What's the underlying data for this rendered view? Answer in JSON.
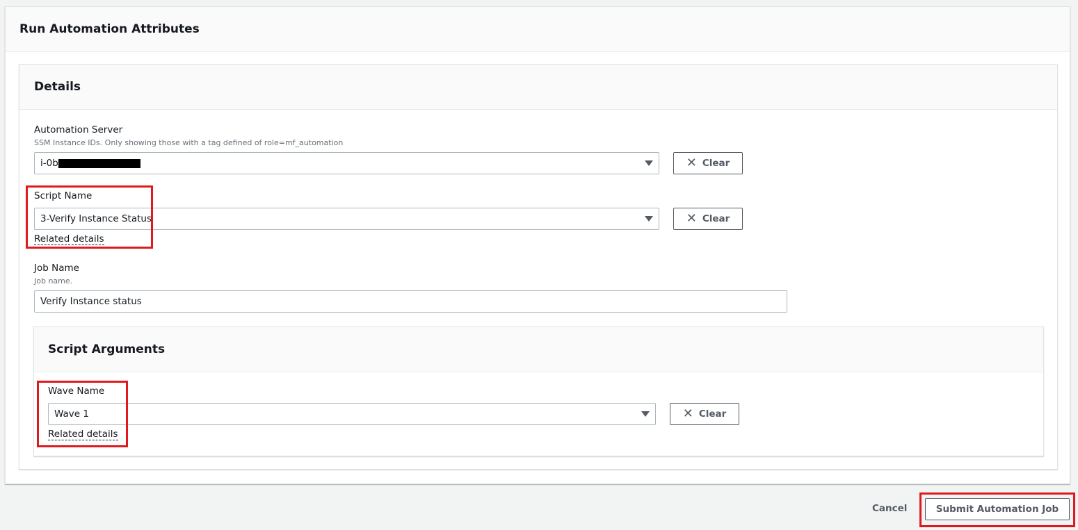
{
  "page": {
    "title": "Run Automation Attributes"
  },
  "details": {
    "title": "Details",
    "automation_server": {
      "label": "Automation Server",
      "description": "SSM Instance IDs. Only showing those with a tag defined of role=mf_automation",
      "value": "i-0b",
      "clear_label": "Clear"
    },
    "script_name": {
      "label": "Script Name",
      "value": "3-Verify Instance Status",
      "clear_label": "Clear",
      "related_link": "Related details"
    },
    "job_name": {
      "label": "Job Name",
      "description": "Job name.",
      "value": "Verify Instance status"
    }
  },
  "script_arguments": {
    "title": "Script Arguments",
    "wave_name": {
      "label": "Wave Name",
      "value": "Wave 1",
      "clear_label": "Clear",
      "related_link": "Related details"
    }
  },
  "footer": {
    "cancel_label": "Cancel",
    "submit_label": "Submit Automation Job"
  },
  "colors": {
    "highlight": "#e0191f",
    "text": "#16191f",
    "button_text": "#545b64"
  }
}
